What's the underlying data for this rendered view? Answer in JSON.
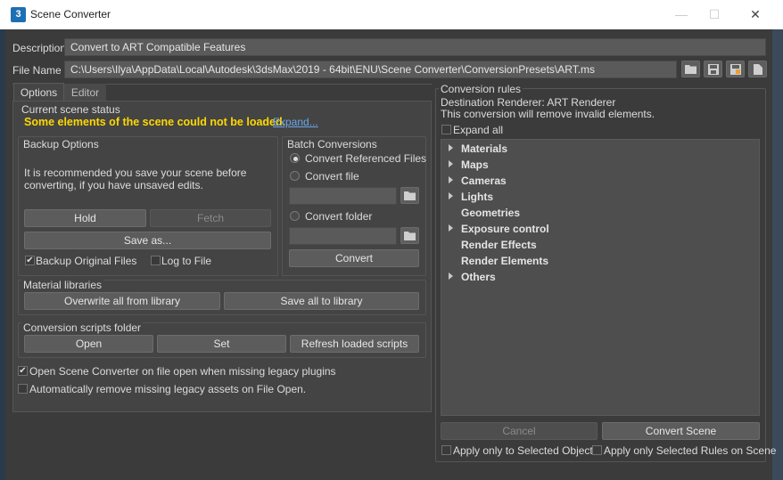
{
  "window": {
    "title": "Scene Converter",
    "app_icon": "3",
    "min_icon": "—",
    "max_icon": "☐",
    "close_icon": "✕"
  },
  "description": {
    "label": "Description",
    "value": "Convert to ART Compatible Features"
  },
  "filename": {
    "label": "File Name",
    "value": "C:\\Users\\Ilya\\AppData\\Local\\Autodesk\\3dsMax\\2019 - 64bit\\ENU\\Scene Converter\\ConversionPresets\\ART.ms"
  },
  "tabs": [
    {
      "label": "Options"
    },
    {
      "label": "Editor"
    }
  ],
  "scene_status": {
    "label": "Current scene status",
    "message": "Some elements of the scene could not be loaded.",
    "link": "Expand..."
  },
  "backup": {
    "label": "Backup Options",
    "note_line1": "It is recommended you save your scene before",
    "note_line2": "converting, if you have unsaved edits.",
    "hold": "Hold",
    "fetch": "Fetch",
    "save_as": "Save as...",
    "backup_original": "Backup Original Files",
    "log_to_file": "Log to File"
  },
  "batch": {
    "label": "Batch Conversions",
    "convert_referenced": "Convert Referenced Files",
    "convert_file": "Convert file",
    "convert_folder": "Convert folder",
    "convert": "Convert"
  },
  "material_libraries": {
    "label": "Material libraries",
    "overwrite": "Overwrite all from library",
    "save_all": "Save all to library"
  },
  "scripts": {
    "label": "Conversion scripts folder",
    "open": "Open",
    "set": "Set",
    "refresh": "Refresh loaded scripts"
  },
  "options": {
    "open_on_missing": "Open Scene Converter on file open when missing legacy plugins",
    "auto_remove": "Automatically remove missing legacy assets on File Open."
  },
  "rules": {
    "label": "Conversion rules",
    "destination": "Destination Renderer: ART Renderer",
    "note": "This conversion will remove invalid elements.",
    "expand_all": "Expand all",
    "items": [
      {
        "label": "Materials"
      },
      {
        "label": "Maps"
      },
      {
        "label": "Cameras"
      },
      {
        "label": "Lights"
      },
      {
        "label": "Geometries"
      },
      {
        "label": "Exposure control"
      },
      {
        "label": "Render Effects"
      },
      {
        "label": "Render Elements"
      },
      {
        "label": "Others"
      }
    ],
    "cancel": "Cancel",
    "convert_scene": "Convert Scene",
    "apply_selected_objects": "Apply only to Selected Objects",
    "apply_selected_rules": "Apply only Selected Rules on Scene"
  },
  "colors": {
    "warning": "#ffd800",
    "link": "#6aa6e8",
    "panel": "#3b3b3b"
  }
}
